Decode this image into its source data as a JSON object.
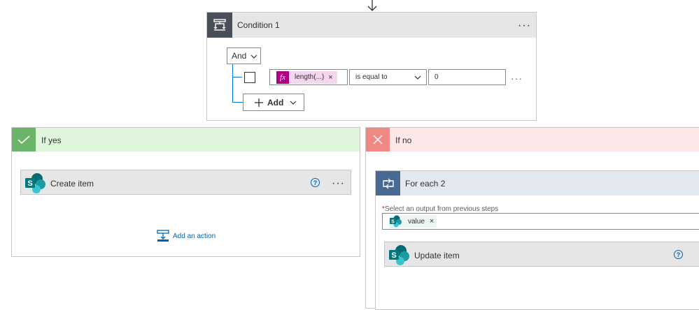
{
  "condition": {
    "title": "Condition 1",
    "more": "···",
    "group_operator": "And",
    "row": {
      "token_label": "length(...)",
      "token_icon": "fx-icon",
      "token_remove": "×",
      "operator": "is equal to",
      "value": "0",
      "more": "···"
    },
    "add_label": "Add"
  },
  "if_yes": {
    "title": "If yes",
    "action_title": "Create item",
    "help": "?",
    "more": "···",
    "add_action_label": "Add an action"
  },
  "if_no": {
    "title": "If no",
    "foreach_title": "For each 2",
    "select_label": "Select an output from previous steps",
    "required_mark": "*",
    "token_label": "value",
    "token_remove": "×",
    "inner_action_title": "Update item",
    "help": "?"
  },
  "colors": {
    "condition_icon_bg": "#484f58",
    "yes_header": "#dff6dd",
    "yes_icon": "#6bb56a",
    "no_header": "#fde7e9",
    "no_icon": "#f08883",
    "foreach_icon": "#486991",
    "expression_token": "#f4d6ef",
    "link_blue": "#0063b1"
  }
}
